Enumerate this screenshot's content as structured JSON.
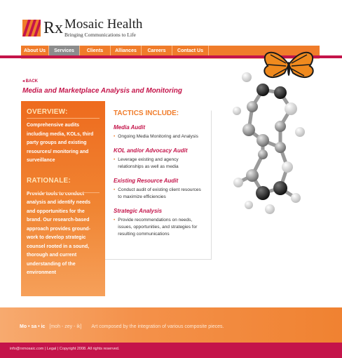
{
  "brand": {
    "rx": "Rx",
    "name": "Mosaic Health",
    "tagline": "Bringing Communications to Life"
  },
  "nav": {
    "items": [
      {
        "label": "About Us",
        "active": false
      },
      {
        "label": "Services",
        "active": true
      },
      {
        "label": "Clients",
        "active": false
      },
      {
        "label": "Alliances",
        "active": false
      },
      {
        "label": "Careers",
        "active": false
      },
      {
        "label": "Contact Us",
        "active": false
      }
    ]
  },
  "page": {
    "back_label": "◂ BACK",
    "title": "Media and Marketplace Analysis and Monitoring"
  },
  "sidebar": {
    "overview_heading": "OVERVIEW:",
    "overview_text": "Comprehensive audits including media, KOLs, third party groups and existing resources/ monitoring and surveillance",
    "rationale_heading": "RATIONALE:",
    "rationale_text": "Provide tools to conduct analysis and identify needs and opportunities for the brand. Our research-based approach provides ground-work to develop strategic counsel rooted in a sound, thorough and current understanding of the environment"
  },
  "tactics": {
    "heading": "TACTICS INCLUDE:",
    "sections": [
      {
        "title": "Media Audit",
        "bullet": "Ongoing Media Monitoring and Analysis"
      },
      {
        "title": "KOL and/or Advocacy Audit",
        "bullet": "Leverage existing and agency relationships as well as media"
      },
      {
        "title": "Existing Resource Audit",
        "bullet": "Conduct audit of existing client resources to maximize efficiencies"
      },
      {
        "title": "Strategic Analysis",
        "bullet": "Provide recommendations on needs, issues, opportunities, and strategies for resulting communications"
      }
    ]
  },
  "definition": {
    "word": "Mo • sa • ic",
    "pronunciation": "[moh - zey - ik]",
    "meaning": "Art composed by the integration of various composite pieces."
  },
  "footer": {
    "text": "info@rxmosaic.com | Legal | Copyright 2008. All rights reserved."
  },
  "colors": {
    "orange": "#f07c2a",
    "crimson": "#c4144a",
    "nav_active": "#8c8c8c"
  }
}
